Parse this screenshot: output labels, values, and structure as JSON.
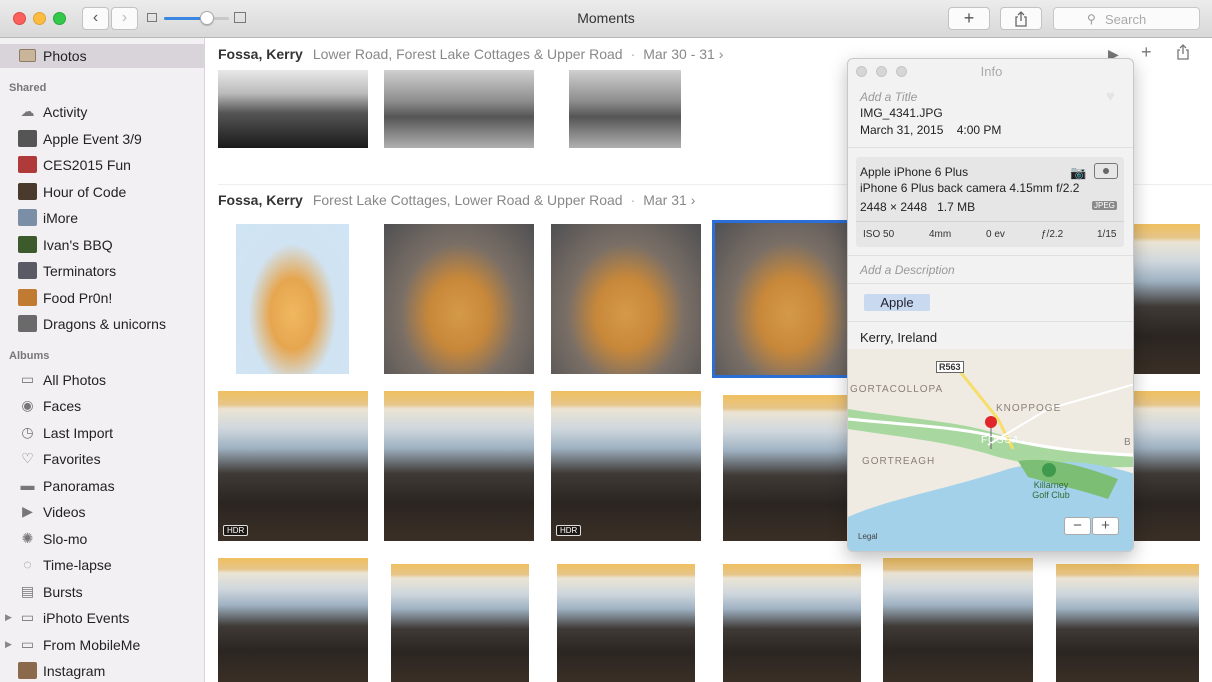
{
  "window": {
    "title": "Moments"
  },
  "toolbar": {
    "search_placeholder": "Search"
  },
  "sidebar": {
    "photos_label": "Photos",
    "shared_header": "Shared",
    "albums_header": "Albums",
    "shared_items": [
      {
        "label": "Activity",
        "icon": "cloud-icon"
      },
      {
        "label": "Apple Event 3/9",
        "icon": "album-thumb"
      },
      {
        "label": "CES2015 Fun",
        "icon": "album-thumb"
      },
      {
        "label": "Hour of Code",
        "icon": "album-thumb"
      },
      {
        "label": "iMore",
        "icon": "album-thumb"
      },
      {
        "label": "Ivan's BBQ",
        "icon": "album-thumb"
      },
      {
        "label": "Terminators",
        "icon": "album-thumb"
      },
      {
        "label": "Food Pr0n!",
        "icon": "album-thumb"
      },
      {
        "label": "Dragons & unicorns",
        "icon": "album-thumb"
      }
    ],
    "album_items": [
      {
        "label": "All Photos",
        "icon": "all-photos-icon"
      },
      {
        "label": "Faces",
        "icon": "faces-icon"
      },
      {
        "label": "Last Import",
        "icon": "clock-icon"
      },
      {
        "label": "Favorites",
        "icon": "heart-icon"
      },
      {
        "label": "Panoramas",
        "icon": "panorama-icon"
      },
      {
        "label": "Videos",
        "icon": "video-icon"
      },
      {
        "label": "Slo-mo",
        "icon": "slomo-icon"
      },
      {
        "label": "Time-lapse",
        "icon": "timelapse-icon"
      },
      {
        "label": "Bursts",
        "icon": "bursts-icon"
      },
      {
        "label": "iPhoto Events",
        "icon": "folder-icon"
      },
      {
        "label": "From MobileMe",
        "icon": "folder-icon"
      },
      {
        "label": "Instagram",
        "icon": "album-thumb"
      }
    ]
  },
  "moments": [
    {
      "name": "Fossa, Kerry",
      "places": "Lower Road, Forest Lake Cottages & Upper Road",
      "date": "Mar 30 - 31"
    },
    {
      "name": "Fossa, Kerry",
      "places": "Forest Lake Cottages, Lower Road & Upper Road",
      "date": "Mar 31"
    }
  ],
  "hdr_badge": "HDR",
  "info": {
    "title": "Info",
    "add_title_placeholder": "Add a Title",
    "filename": "IMG_4341.JPG",
    "date": "March 31, 2015",
    "time": "4:00 PM",
    "camera": "Apple iPhone 6 Plus",
    "lens": "iPhone 6 Plus back camera 4.15mm f/2.2",
    "dimensions": "2448 × 2448",
    "filesize": "1.7 MB",
    "format": "JPEG",
    "exif": [
      "ISO 50",
      "4mm",
      "0 ev",
      "ƒ/2.2",
      "1/15"
    ],
    "add_description_placeholder": "Add a Description",
    "keyword": "Apple",
    "location": "Kerry, Ireland",
    "map": {
      "road_sign": "R563",
      "labels": [
        "GORTACOLLOPA",
        "KNOPPOGE",
        "FOSSA",
        "GORTREAGH",
        "Killarney Golf Club",
        "B"
      ],
      "legal": "Legal"
    }
  }
}
